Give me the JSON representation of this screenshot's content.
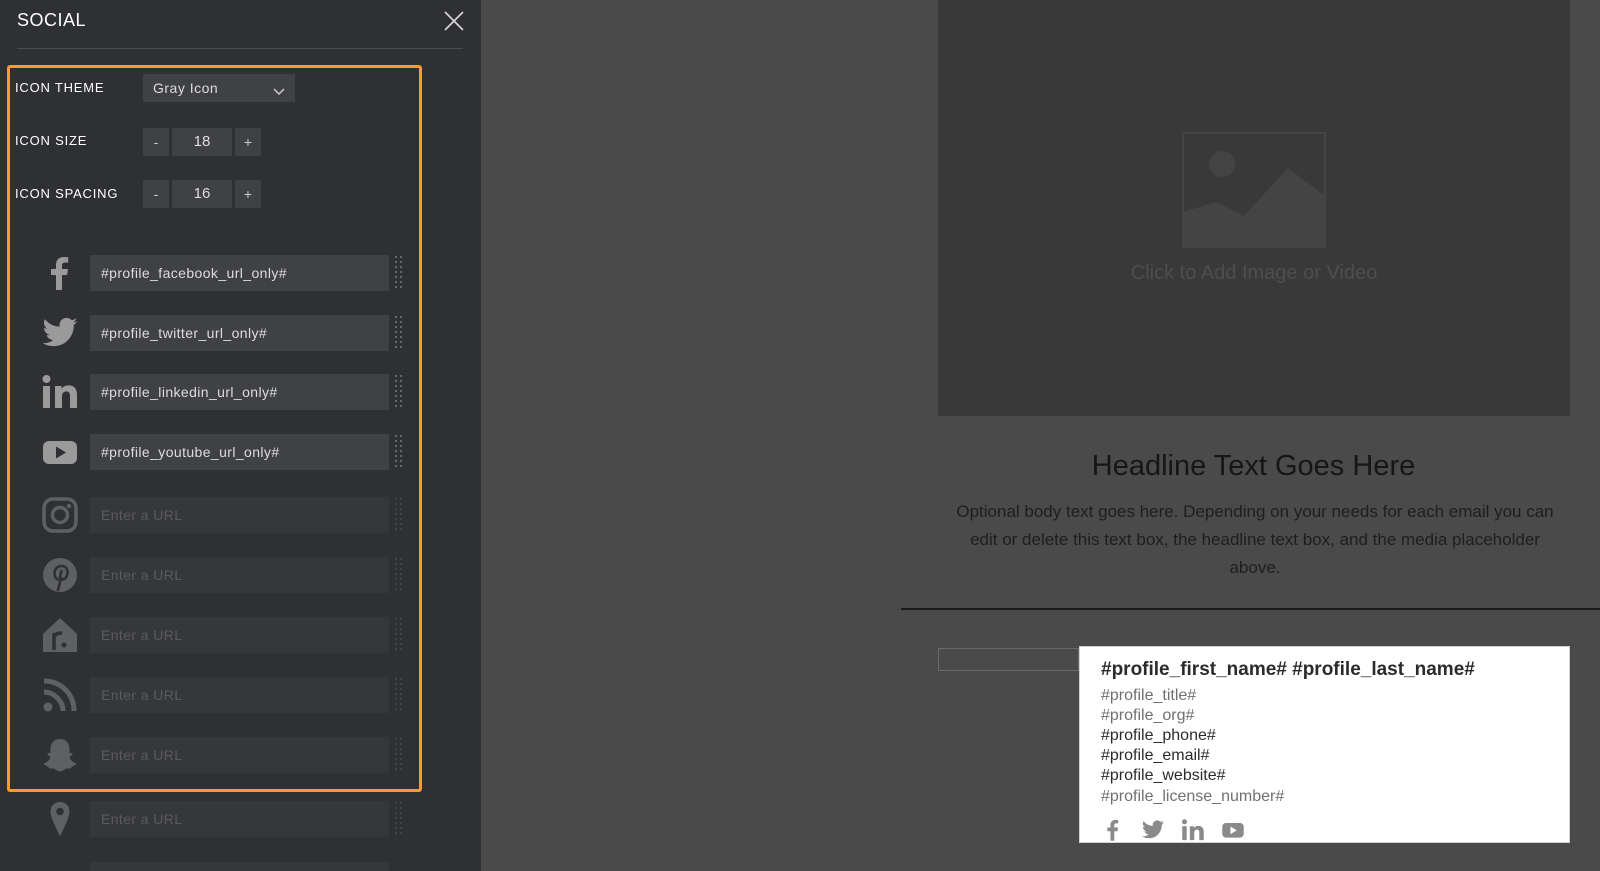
{
  "panel": {
    "title": "SOCIAL",
    "settings": {
      "icon_theme_label": "ICON THEME",
      "icon_theme_value": "Gray Icon",
      "icon_size_label": "ICON SIZE",
      "icon_size_value": "18",
      "icon_spacing_label": "ICON SPACING",
      "icon_spacing_value": "16",
      "minus": "-",
      "plus": "+"
    },
    "rows": [
      {
        "icon": "facebook-icon",
        "value": "#profile_facebook_url_only#"
      },
      {
        "icon": "twitter-icon",
        "value": "#profile_twitter_url_only#"
      },
      {
        "icon": "linkedin-icon",
        "value": "#profile_linkedin_url_only#"
      },
      {
        "icon": "youtube-icon",
        "value": "#profile_youtube_url_only#"
      },
      {
        "icon": "instagram-icon",
        "placeholder": "Enter a URL"
      },
      {
        "icon": "pinterest-icon",
        "placeholder": "Enter a URL"
      },
      {
        "icon": "realtor-icon",
        "placeholder": "Enter a URL"
      },
      {
        "icon": "rss-icon",
        "placeholder": "Enter a URL"
      },
      {
        "icon": "snapchat-icon",
        "placeholder": "Enter a URL"
      },
      {
        "icon": "location-pin-icon",
        "placeholder": "Enter a URL"
      }
    ],
    "highlight_color": "#f5a020"
  },
  "preview": {
    "media_caption": "Click to Add Image or Video",
    "headline": "Headline Text Goes Here",
    "body": "Optional body text goes here. Depending on your needs for each email you can edit or delete this text box, the headline text box, and the media placeholder above.",
    "signature": {
      "name": "#profile_first_name# #profile_last_name#",
      "title": "#profile_title#",
      "org": "#profile_org#",
      "phone": "#profile_phone#",
      "email": "#profile_email#",
      "website": "#profile_website#",
      "license": "#profile_license_number#",
      "icons": [
        "facebook-icon",
        "twitter-icon",
        "linkedin-icon",
        "youtube-icon"
      ]
    }
  }
}
